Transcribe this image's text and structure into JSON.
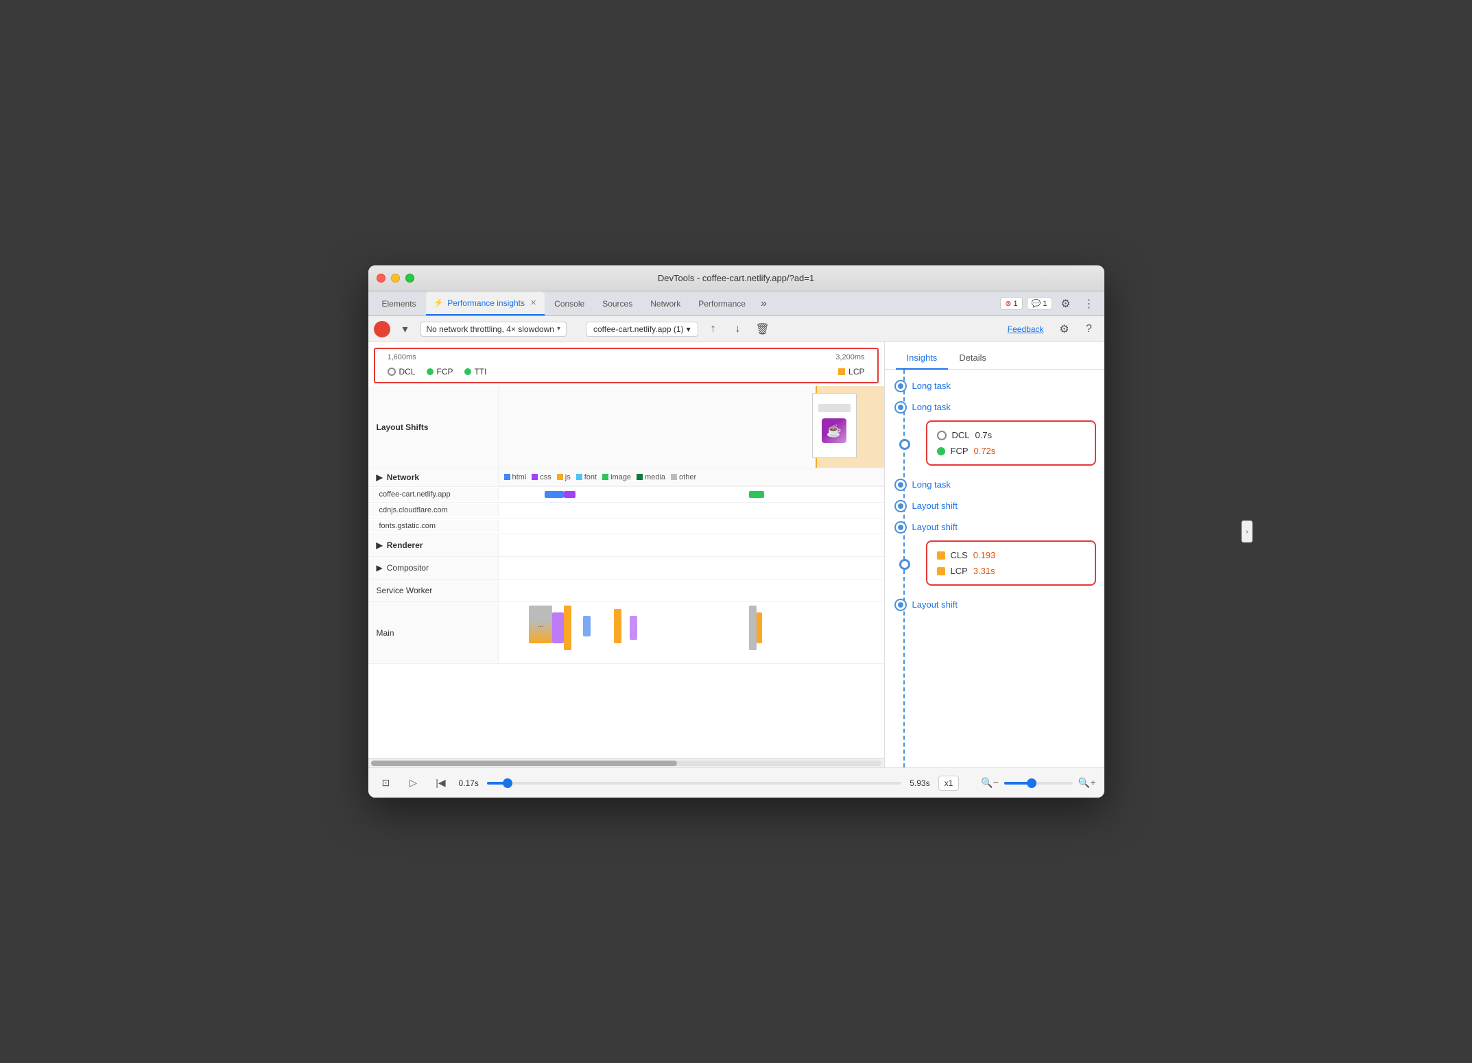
{
  "window": {
    "title": "DevTools - coffee-cart.netlify.app/?ad=1"
  },
  "tabs": [
    {
      "label": "Elements",
      "active": false,
      "icon": ""
    },
    {
      "label": "Performance insights",
      "active": true,
      "icon": "⚡",
      "closable": true
    },
    {
      "label": "Console",
      "active": false
    },
    {
      "label": "Sources",
      "active": false
    },
    {
      "label": "Network",
      "active": false
    },
    {
      "label": "Performance",
      "active": false
    }
  ],
  "toolbar": {
    "record_btn_label": "Record",
    "throttling": "No network throttling, 4× slowdown",
    "url": "coffee-cart.netlify.app (1)",
    "feedback_label": "Feedback"
  },
  "timeline": {
    "marker_1600": "1,600ms",
    "marker_3200": "3,200ms",
    "dcl_label": "DCL",
    "fcp_label": "FCP",
    "tti_label": "TTI",
    "lcp_label": "LCP",
    "layout_shifts_label": "Layout Shifts",
    "network_label": "Network",
    "renderer_label": "Renderer",
    "compositor_label": "Compositor",
    "service_worker_label": "Service Worker",
    "main_label": "Main",
    "legend": {
      "html": "html",
      "css": "css",
      "js": "js",
      "font": "font",
      "image": "image",
      "media": "media",
      "other": "other"
    },
    "network_hosts": [
      "coffee-cart.netlify.app",
      "cdnjs.cloudflare.com",
      "fonts.gstatic.com"
    ]
  },
  "playback": {
    "start_time": "0.17s",
    "end_time": "5.93s",
    "speed": "x1",
    "zoom_in": "+",
    "zoom_out": "−"
  },
  "insights": {
    "tabs": [
      "Insights",
      "Details"
    ],
    "active_tab": "Insights",
    "items": [
      {
        "type": "link",
        "label": "Long task"
      },
      {
        "type": "link",
        "label": "Long task"
      },
      {
        "type": "metric_box",
        "metrics": [
          {
            "icon": "circle",
            "label": "DCL",
            "value": "0.7s",
            "value_color": "normal"
          },
          {
            "icon": "green_dot",
            "label": "FCP",
            "value": "0.72s",
            "value_color": "orange"
          }
        ]
      },
      {
        "type": "link",
        "label": "Long task"
      },
      {
        "type": "link",
        "label": "Layout shift"
      },
      {
        "type": "link",
        "label": "Layout shift"
      },
      {
        "type": "metric_box",
        "metrics": [
          {
            "icon": "square",
            "label": "CLS",
            "value": "0.193",
            "value_color": "orange"
          },
          {
            "icon": "square",
            "label": "LCP",
            "value": "3.31s",
            "value_color": "orange"
          }
        ]
      },
      {
        "type": "link",
        "label": "Layout shift"
      }
    ]
  },
  "colors": {
    "accent_blue": "#1a73e8",
    "timeline_blue": "#4a90d9",
    "red_border": "#e53935",
    "orange": "#f9a825",
    "green": "#2ec45a",
    "lcp_orange": "rgba(249,168,37,0.3)"
  }
}
